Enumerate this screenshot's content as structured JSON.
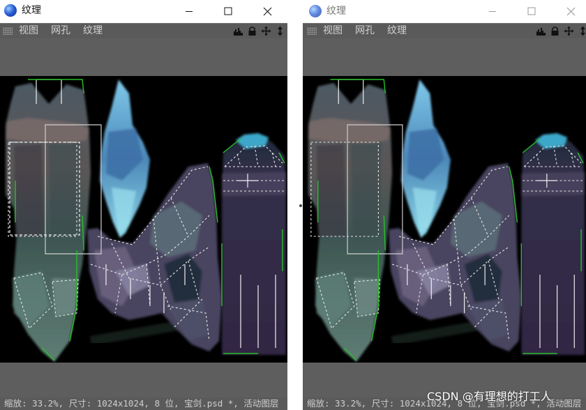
{
  "windows": [
    {
      "title": "纹理",
      "menu": [
        "视图",
        "网孔",
        "纹理"
      ],
      "status": "缩放: 33.2%, 尺寸: 1024x1024, 8 位, 宝剑.psd *, 活动图层"
    },
    {
      "title": "纹理",
      "menu": [
        "视图",
        "网孔",
        "纹理"
      ],
      "status": "缩放: 33.2%, 尺寸: 1024x1024, 8 位, 宝剑.psd *, 活动图层"
    }
  ],
  "icons": {
    "app": "cinema4d-sphere-icon",
    "minimize": "minimize-icon",
    "maximize": "maximize-icon",
    "close": "close-icon",
    "toolbar": [
      "histogram-icon",
      "lock-icon",
      "move-icon",
      "vertical-arrows-icon"
    ]
  },
  "colors": {
    "menubar": "#5a5a5a",
    "panel": "#5e5e5e",
    "canvas_bg": "#000000",
    "uv_edge": "#ffffff",
    "uv_border": "#22c022"
  },
  "watermark": "CSDN @有理想的打工人"
}
